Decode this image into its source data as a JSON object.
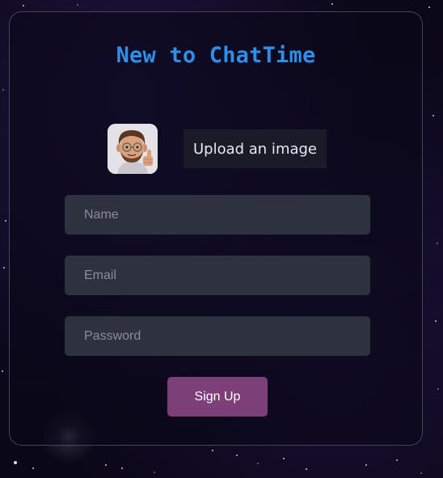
{
  "page": {
    "title": "New to ChatTime"
  },
  "avatar": {
    "icon": "memoji-thumbs-up-icon"
  },
  "upload": {
    "label": "Upload an image"
  },
  "form": {
    "name_placeholder": "Name",
    "email_placeholder": "Email",
    "password_placeholder": "Password",
    "submit_label": "Sign Up"
  },
  "colors": {
    "title": "#2e8ee8",
    "input_bg": "#2e323e",
    "submit_bg": "#7d3f78",
    "upload_bg": "#1a1b29"
  }
}
